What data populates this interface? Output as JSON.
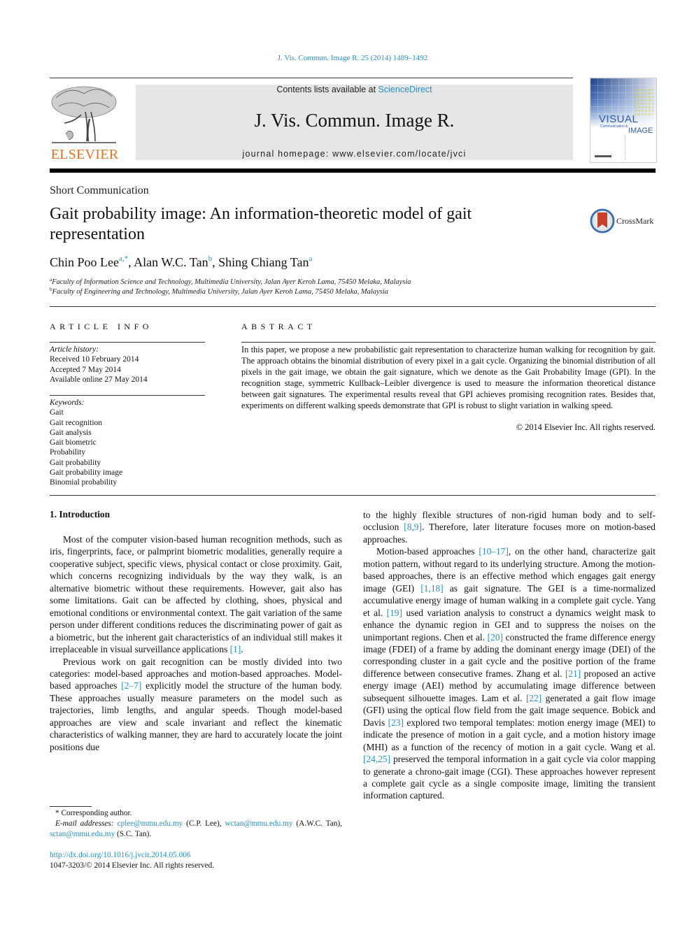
{
  "citation": "J. Vis. Commun. Image R. 25 (2014) 1489–1492",
  "publisher": {
    "wordmark": "ELSEVIER"
  },
  "journal_box": {
    "contents_prefix": "Contents lists available at ",
    "contents_link": "ScienceDirect",
    "journal_name": "J. Vis. Commun. Image R.",
    "homepage": "journal homepage: www.elsevier.com/locate/jvci"
  },
  "cover": {
    "visual": "VISUAL",
    "sub": "Communication &",
    "image": "IMAGE"
  },
  "article_type": "Short Communication",
  "title": "Gait probability image: An information-theoretic model of gait representation",
  "crossmark_label": "CrossMark",
  "authors": [
    {
      "name": "Chin Poo Lee",
      "sup": "a,*"
    },
    {
      "name": "Alan W.C. Tan",
      "sup": "b"
    },
    {
      "name": "Shing Chiang Tan",
      "sup": "a"
    }
  ],
  "affiliations": [
    {
      "mark": "a",
      "text": "Faculty of Information Science and Technology, Multimedia University, Jalan Ayer Keroh Lama, 75450 Melaka, Malaysia"
    },
    {
      "mark": "b",
      "text": "Faculty of Engineering and Technology, Multimedia University, Jalan Ayer Keroh Lama, 75450 Melaka, Malaysia"
    }
  ],
  "article_info": {
    "heading": "ARTICLE INFO",
    "history_label": "Article history:",
    "history": [
      "Received 10 February 2014",
      "Accepted 7 May 2014",
      "Available online 27 May 2014"
    ],
    "keywords_label": "Keywords:",
    "keywords": [
      "Gait",
      "Gait recognition",
      "Gait analysis",
      "Gait biometric",
      "Probability",
      "Gait probability",
      "Gait probability image",
      "Binomial probability"
    ]
  },
  "abstract": {
    "heading": "ABSTRACT",
    "text": "In this paper, we propose a new probabilistic gait representation to characterize human walking for recognition by gait. The approach obtains the binomial distribution of every pixel in a gait cycle. Organizing the binomial distribution of all pixels in the gait image, we obtain the gait signature, which we denote as the Gait Probability Image (GPI). In the recognition stage, symmetric Kullback–Leibler divergence is used to measure the information theoretical distance between gait signatures. The experimental results reveal that GPI achieves promising recognition rates. Besides that, experiments on different walking speeds demonstrate that GPI is robust to slight variation in walking speed.",
    "copyright": "© 2014 Elsevier Inc. All rights reserved."
  },
  "intro": {
    "heading": "1. Introduction",
    "p1_a": "Most of the computer vision-based human recognition methods, such as iris, fingerprints, face, or palmprint biometric modalities, generally require a cooperative subject, specific views, physical contact or close proximity. Gait, which concerns recognizing individuals by the way they walk, is an alternative biometric without these requirements. However, gait also has some limitations. Gait can be affected by clothing, shoes, physical and emotional conditions or environmental context. The gait variation of the same person under different conditions reduces the discriminating power of gait as a biometric, but the inherent gait characteristics of an individual still makes it irreplaceable in visual surveillance applications ",
    "ref_1": "[1]",
    "p1_b": ".",
    "p2_a": "Previous work on gait recognition can be mostly divided into two categories: model-based approaches and motion-based approaches. Model-based approaches ",
    "ref_2_7": "[2–7]",
    "p2_b": " explicitly model the structure of the human body. These approaches usually measure parameters on the model such as trajectories, limb lengths, and angular speeds. Though model-based approaches are view and scale invariant and reflect the kinematic characteristics of walking manner, they are hard to accurately locate the joint positions due to the highly flexible structures of non-rigid human body and to self-occlusion ",
    "ref_8_9": "[8,9]",
    "p2_c": ". Therefore, later literature focuses more on motion-based approaches.",
    "p3_a": "Motion-based approaches ",
    "ref_10_17": "[10–17]",
    "p3_b": ", on the other hand, characterize gait motion pattern, without regard to its underlying structure. Among the motion-based approaches, there is an effective method which engages gait energy image (GEI) ",
    "ref_1_18": "[1,18]",
    "p3_c": " as gait signature. The GEI is a time-normalized accumulative energy image of human walking in a complete gait cycle. Yang et al. ",
    "ref_19": "[19]",
    "p3_d": " used variation analysis to construct a dynamics weight mask to enhance the dynamic region in GEI and to suppress the noises on the unimportant regions. Chen et al. ",
    "ref_20": "[20]",
    "p3_e": " constructed the frame difference energy image (FDEI) of a frame by adding the dominant energy image (DEI) of the corresponding cluster in a gait cycle and the positive portion of the frame difference between consecutive frames. Zhang et al. ",
    "ref_21": "[21]",
    "p3_f": " proposed an active energy image (AEI) method by accumulating image difference between subsequent silhouette images. Lam et al. ",
    "ref_22": "[22]",
    "p3_g": " generated a gait flow image (GFI) using the optical flow field from the gait image sequence. Bobick and Davis ",
    "ref_23": "[23]",
    "p3_h": " explored two temporal templates: motion energy image (MEI) to indicate the presence of motion in a gait cycle, and a motion history image (MHI) as a function of the recency of motion in a gait cycle. Wang et al. ",
    "ref_24_25": "[24,25]",
    "p3_i": " preserved the temporal information in a gait cycle via color mapping to generate a chrono-gait image (CGI). These approaches however represent a complete gait cycle as a single composite image, limiting the transient information captured."
  },
  "footnotes": {
    "corresponding": "* Corresponding author.",
    "email_label": "E-mail addresses:",
    "emails": [
      {
        "address": "cplee@mmu.edu.my",
        "who": " (C.P. Lee), "
      },
      {
        "address": "wctan@mmu.edu.my",
        "who": " (A.W.C. Tan), "
      },
      {
        "address": "sctan@mmu.edu.my",
        "who": " (S.C. Tan)."
      }
    ],
    "doi": "http://dx.doi.org/10.1016/j.jvcir.2014.05.006",
    "issn": "1047-3203/© 2014 Elsevier Inc. All rights reserved."
  }
}
